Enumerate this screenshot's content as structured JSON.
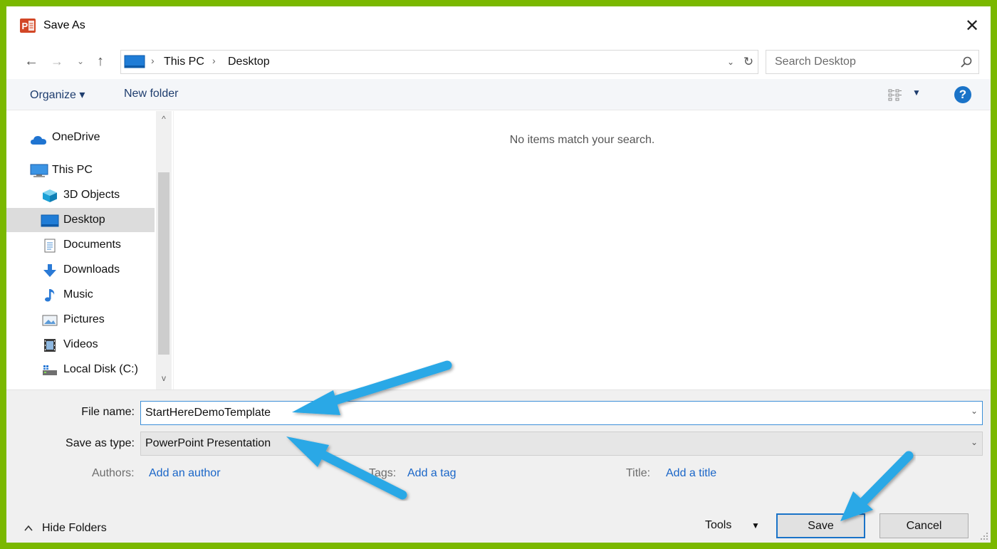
{
  "window": {
    "title": "Save As",
    "close_glyph": "✕",
    "app_icon_letter": "P"
  },
  "nav_buttons": {
    "back": "←",
    "forward": "→",
    "recent": "⌄",
    "up": "↑"
  },
  "address": {
    "crumbs": [
      "This PC",
      "Desktop"
    ],
    "separator": "›",
    "dropdown_glyph": "⌄",
    "refresh_glyph": "↻"
  },
  "search": {
    "placeholder": "Search Desktop"
  },
  "toolbar": {
    "organize_label": "Organize ▾",
    "new_folder_label": "New folder",
    "view_caret": "▼",
    "help_label": "?"
  },
  "sidebar": {
    "items": [
      {
        "label": "OneDrive",
        "icon": "cloud-icon"
      },
      {
        "label": "This PC",
        "icon": "computer-icon"
      },
      {
        "label": "3D Objects",
        "icon": "cube-icon"
      },
      {
        "label": "Desktop",
        "icon": "desktop-icon",
        "selected": true
      },
      {
        "label": "Documents",
        "icon": "document-icon"
      },
      {
        "label": "Downloads",
        "icon": "download-icon"
      },
      {
        "label": "Music",
        "icon": "music-icon"
      },
      {
        "label": "Pictures",
        "icon": "picture-icon"
      },
      {
        "label": "Videos",
        "icon": "video-icon"
      },
      {
        "label": "Local Disk (C:)",
        "icon": "drive-icon"
      }
    ],
    "scroll_up": "^",
    "scroll_down": "v"
  },
  "content": {
    "empty_message": "No items match your search."
  },
  "form": {
    "file_name_label": "File name:",
    "file_name_value": "StartHereDemoTemplate",
    "save_type_label": "Save as type:",
    "save_type_value": "PowerPoint Presentation",
    "dropdown_glyph": "⌄",
    "authors_label": "Authors:",
    "authors_link": "Add an author",
    "tags_label": "Tags:",
    "tags_link": "Add a tag",
    "title_label": "Title:",
    "title_link": "Add a title"
  },
  "footer": {
    "hide_folders_caret": "^",
    "hide_folders_label": "Hide Folders",
    "tools_label": "Tools",
    "tools_caret": "▼",
    "save_label": "Save",
    "cancel_label": "Cancel"
  },
  "colors": {
    "frame_border": "#7ab800",
    "accent": "#1a73c8",
    "annotation_arrow": "#2aa8e6",
    "link": "#1a66c8"
  }
}
